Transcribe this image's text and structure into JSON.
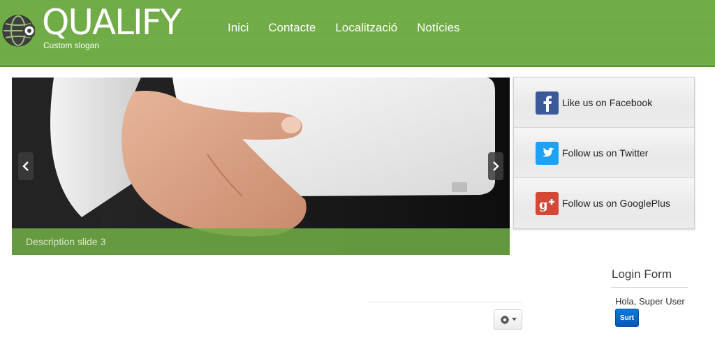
{
  "site": {
    "logo_text": "QUALIFY",
    "slogan": "Custom slogan"
  },
  "nav": {
    "items": [
      {
        "label": "Inici"
      },
      {
        "label": "Contacte"
      },
      {
        "label": "Localització"
      },
      {
        "label": "Notícies"
      }
    ]
  },
  "slider": {
    "caption": "Description slide 3",
    "prev_icon": "chevron-left-icon",
    "next_icon": "chevron-right-icon"
  },
  "social": {
    "items": [
      {
        "label": "Like us on Facebook",
        "icon": "facebook-icon",
        "color": "#3b5998"
      },
      {
        "label": "Follow us on Twitter",
        "icon": "twitter-icon",
        "color": "#1da1f2"
      },
      {
        "label": "Follow us on GooglePlus",
        "icon": "googleplus-icon",
        "color": "#d34836"
      }
    ]
  },
  "login": {
    "title": "Login Form",
    "greeting": "Hola,  Super User",
    "logout_label": "Surt"
  },
  "colors": {
    "header_green": "#6fab45",
    "button_blue": "#0a6fd0"
  }
}
